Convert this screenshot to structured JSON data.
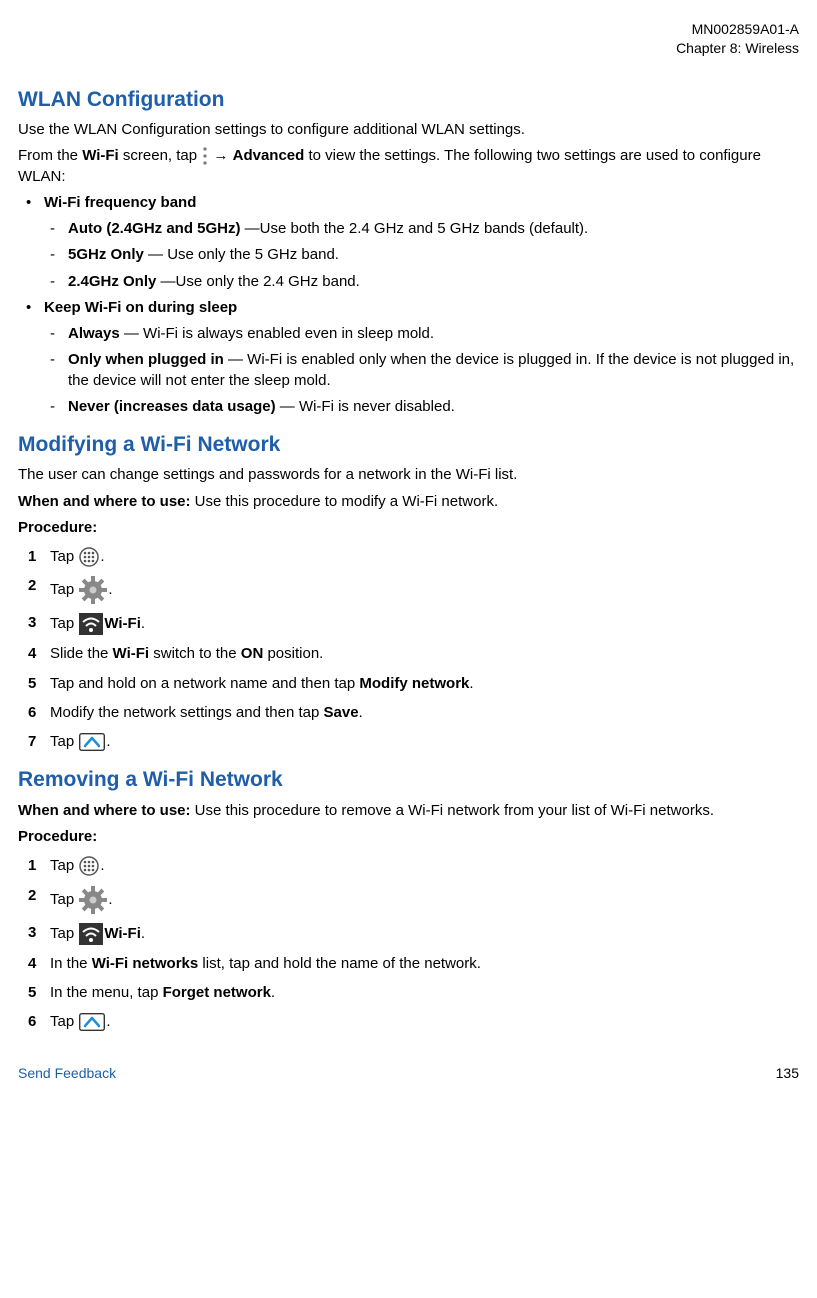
{
  "header": {
    "doc_id": "MN002859A01-A",
    "chapter": "Chapter 8:  Wireless"
  },
  "section1": {
    "title": "WLAN Configuration",
    "intro": "Use the WLAN Configuration settings to configure additional WLAN settings.",
    "from_pre": "From the ",
    "from_wifi": "Wi-Fi",
    "from_mid": " screen, tap ",
    "from_arrow": " → ",
    "from_adv": "Advanced",
    "from_post": " to view the settings. The following two settings are used to configure WLAN:",
    "b1_label": "Wi-Fi frequency band",
    "b1_d1_strong": "Auto (2.4GHz and 5GHz)",
    "b1_d1_rest": " —Use both the 2.4 GHz and 5 GHz bands (default).",
    "b1_d2_strong": "5GHz Only",
    "b1_d2_rest": " — Use only the 5 GHz band.",
    "b1_d3_strong": "2.4GHz Only",
    "b1_d3_rest": " —Use only the 2.4 GHz band.",
    "b2_label": "Keep Wi-Fi on during sleep",
    "b2_d1_strong": "Always",
    "b2_d1_rest": " — Wi-Fi is always enabled even in sleep mold.",
    "b2_d2_strong": "Only when plugged in",
    "b2_d2_rest": " — Wi-Fi is enabled only when the device is plugged in. If the device is not plugged in, the device will not enter the sleep mold.",
    "b2_d3_strong": "Never (increases data usage)",
    "b2_d3_rest": " — Wi-Fi is never disabled."
  },
  "section2": {
    "title": "Modifying a Wi-Fi Network",
    "intro": "The user can change settings and passwords for a network in the Wi-Fi list.",
    "when_label": "When and where to use:",
    "when_text": " Use this procedure to modify a Wi-Fi network.",
    "proc_label": "Procedure:",
    "tap": "Tap ",
    "dot": ".",
    "s3_wifi": "Wi-Fi",
    "s4_pre": "Slide the ",
    "s4_wifi": "Wi-Fi",
    "s4_mid": " switch to the ",
    "s4_on": "ON",
    "s4_post": " position.",
    "s5_pre": "Tap and hold on a network name and then tap ",
    "s5_strong": "Modify network",
    "s6_pre": "Modify the network settings and then tap ",
    "s6_strong": "Save"
  },
  "section3": {
    "title": "Removing a Wi-Fi Network",
    "when_label": "When and where to use:",
    "when_text": " Use this procedure to remove a Wi-Fi network from your list of Wi-Fi networks.",
    "proc_label": "Procedure:",
    "tap": "Tap ",
    "dot": ".",
    "s3_wifi": "Wi-Fi",
    "s4_pre": "In the ",
    "s4_strong": "Wi-Fi networks",
    "s4_post": " list, tap and hold the name of the network.",
    "s5_pre": "In the menu, tap ",
    "s5_strong": "Forget network"
  },
  "footer": {
    "send": "Send Feedback",
    "page": "135"
  }
}
